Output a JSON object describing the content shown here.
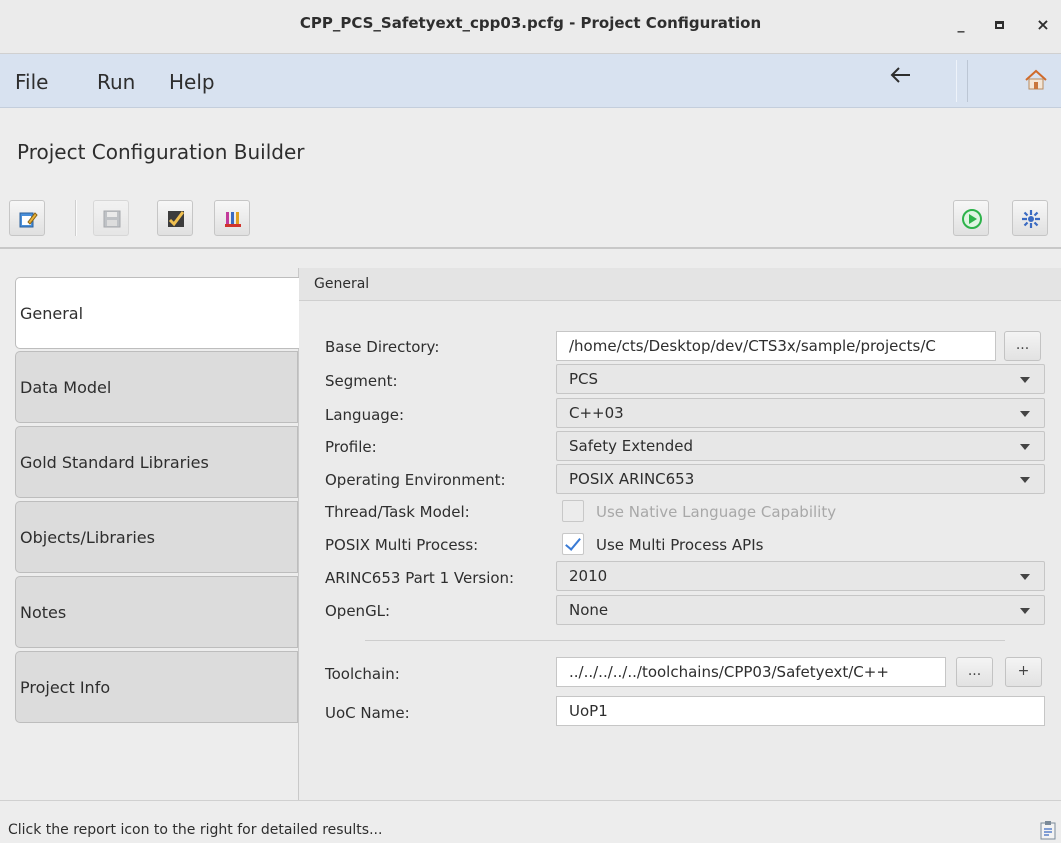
{
  "window": {
    "title": "CPP_PCS_Safetyext_cpp03.pcfg - Project Configuration",
    "minimize": "_",
    "close": "×"
  },
  "menu": {
    "file": "File",
    "run": "Run",
    "help": "Help",
    "back_icon": "left-arrow-icon",
    "home_icon": "home-icon"
  },
  "builder": {
    "title": "Project Configuration Builder"
  },
  "toolbar": {
    "left_icons": [
      "edit-icon",
      "save-icon",
      "validate-icon",
      "report-chart-icon"
    ],
    "right_icons": [
      "run-icon",
      "settings-icon"
    ]
  },
  "tabs": [
    {
      "label": "General",
      "active": true
    },
    {
      "label": "Data Model"
    },
    {
      "label": "Gold Standard Libraries"
    },
    {
      "label": "Objects/Libraries"
    },
    {
      "label": "Notes"
    },
    {
      "label": "Project Info"
    }
  ],
  "panel": {
    "header": "General",
    "base_directory": {
      "label": "Base Directory:",
      "value": "/home/cts/Desktop/dev/CTS3x/sample/projects/C",
      "browse": "..."
    },
    "segment": {
      "label": "Segment:",
      "value": "PCS"
    },
    "language": {
      "label": "Language:",
      "value": "C++03"
    },
    "profile": {
      "label": "Profile:",
      "value": "Safety Extended"
    },
    "operating_environment": {
      "label": "Operating Environment:",
      "value": "POSIX ARINC653"
    },
    "thread_task_model": {
      "label": "Thread/Task Model:",
      "checkbox_label": "Use Native Language Capability",
      "checked": false,
      "enabled": false
    },
    "posix_multi_process": {
      "label": "POSIX Multi Process:",
      "checkbox_label": "Use Multi Process APIs",
      "checked": true
    },
    "arinc653_version": {
      "label": "ARINC653 Part 1 Version:",
      "value": "2010"
    },
    "opengl": {
      "label": "OpenGL:",
      "value": "None"
    },
    "toolchain": {
      "label": "Toolchain:",
      "value": "../../../../../toolchains/CPP03/Safetyext/C++",
      "browse": "...",
      "add": "+"
    },
    "uoc_name": {
      "label": "UoC Name:",
      "value": "UoP1"
    }
  },
  "status": {
    "message": "Click the report icon to the right for detailed results...",
    "icon": "clipboard-report-icon"
  },
  "colors": {
    "menubar_bg": "#d8e2f0",
    "check_accent": "#3a7bd5",
    "run_green": "#2db34a"
  }
}
